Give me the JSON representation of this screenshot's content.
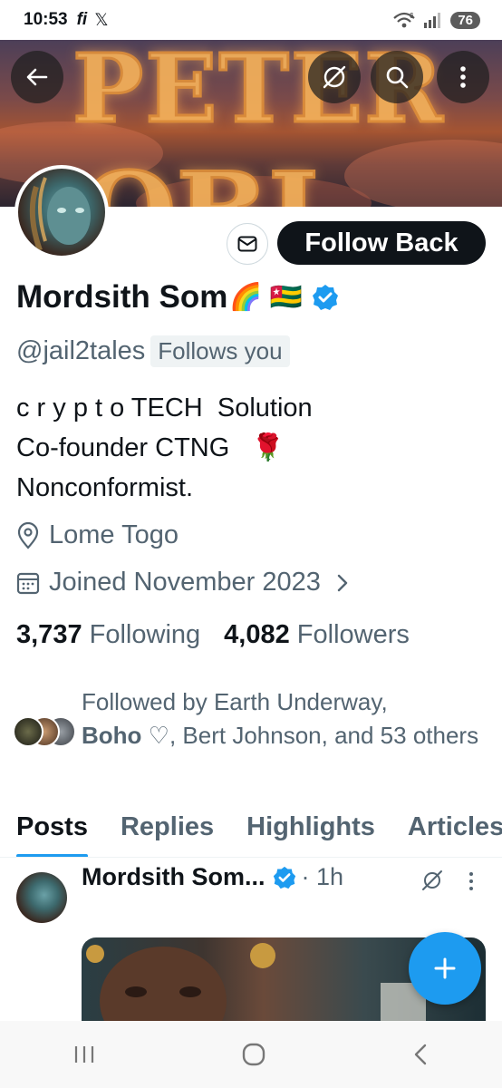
{
  "status_bar": {
    "time": "10:53",
    "notif_icon_1": "fi",
    "notif_icon_2": "𝕏",
    "network": "6",
    "battery": "76"
  },
  "banner": {
    "line1": "PETER",
    "line2": "OBI"
  },
  "profile": {
    "name": "Mordsith Som",
    "name_emojis": "🌈 🇹🇬",
    "handle": "@jail2tales",
    "follows_you": "Follows you",
    "bio_line1": "c r y p t o TECH  Solution",
    "bio_line2": "Co-founder CTNG   🌹",
    "bio_line3": "Nonconformist.",
    "location": "Lome Togo",
    "joined": "Joined November 2023",
    "following_count": "3,737",
    "following_label": "Following",
    "followers_count": "4,082",
    "followers_label": "Followers"
  },
  "actions": {
    "follow_back": "Follow Back"
  },
  "followed_by": {
    "prefix": "Followed by Earth Underway,",
    "bold_name": "Boho",
    "rest": "♡, Bert Johnson, and 53 others"
  },
  "tabs": [
    {
      "label": "Posts"
    },
    {
      "label": "Replies"
    },
    {
      "label": "Highlights"
    },
    {
      "label": "Articles"
    }
  ],
  "post": {
    "author": "Mordsith Som...",
    "time": "· 1h"
  },
  "colors": {
    "accent": "#1d9bf0",
    "text": "#0f1419",
    "muted": "#536471"
  }
}
